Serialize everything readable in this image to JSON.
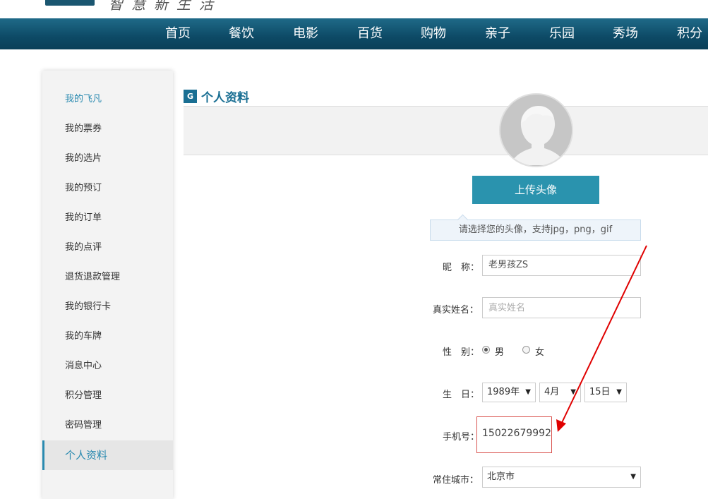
{
  "header": {
    "slogan": "智慧新生活"
  },
  "nav": {
    "items": [
      "首页",
      "餐饮",
      "电影",
      "百货",
      "购物",
      "亲子",
      "乐园",
      "秀场",
      "积分"
    ]
  },
  "sidebar": {
    "items": [
      "我的飞凡",
      "我的票券",
      "我的选片",
      "我的预订",
      "我的订单",
      "我的点评",
      "退货退款管理",
      "我的银行卡",
      "我的车牌",
      "消息中心",
      "积分管理",
      "密码管理",
      "个人资料"
    ]
  },
  "section": {
    "badge": "G",
    "title": "个人资料"
  },
  "profile": {
    "upload_label": "上传头像",
    "upload_hint": "请选择您的头像，支持jpg，png，gif"
  },
  "form": {
    "nickname_label": "昵　称：",
    "nickname_value": "老男孩ZS",
    "realname_label": "真实姓名：",
    "realname_placeholder": "真实姓名",
    "gender_label": "性　别：",
    "gender_male": "男",
    "gender_female": "女",
    "birthday_label": "生　日：",
    "birth_year": "1989年",
    "birth_month": "4月",
    "birth_day": "15日",
    "phone_label": "手机号：",
    "phone_value": "15022679992",
    "city_label": "常住城市：",
    "city_value": "北京市"
  },
  "colors": {
    "nav_bg": "#0d4a66",
    "accent": "#2a93ae",
    "annotation_red": "#e00000"
  }
}
